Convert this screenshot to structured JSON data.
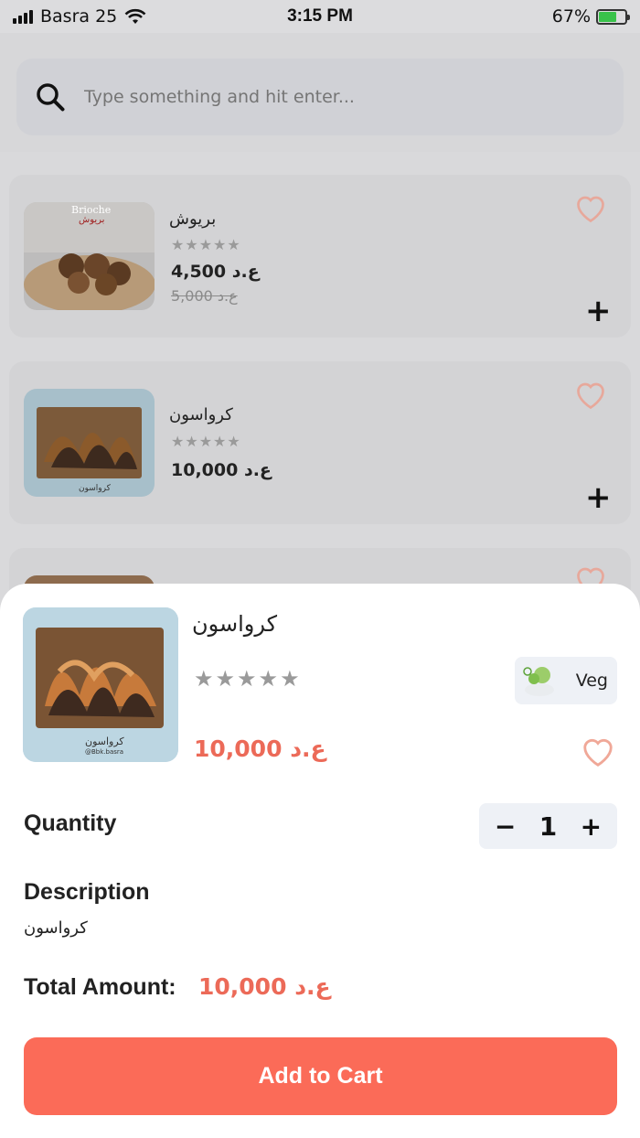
{
  "status_bar": {
    "carrier": "Basra 25",
    "time": "3:15 PM",
    "battery": "67%"
  },
  "search": {
    "placeholder": "Type something and hit enter..."
  },
  "products": [
    {
      "name": "بريوش",
      "price": "ع.د 4,500",
      "old_price": "ع.د 5,000",
      "image_label": "Brioche",
      "image_label_ar": "بريوش"
    },
    {
      "name": "كرواسون",
      "price": "ع.د 10,000",
      "image_label": "كرواسون"
    }
  ],
  "sheet": {
    "name": "كرواسون",
    "price": "ع.د 10,000",
    "veg_label": "Veg",
    "image_caption": "كرواسون",
    "image_handle": "@Bbk.basra",
    "quantity_label": "Quantity",
    "quantity_value": "1",
    "description_label": "Description",
    "description": "كرواسون",
    "total_label": "Total Amount:",
    "total_value": "ع.د 10,000",
    "add_to_cart": "Add to Cart"
  },
  "colors": {
    "accent": "#fb6b58",
    "price": "#ec6a58",
    "heart": "#f0a898"
  }
}
